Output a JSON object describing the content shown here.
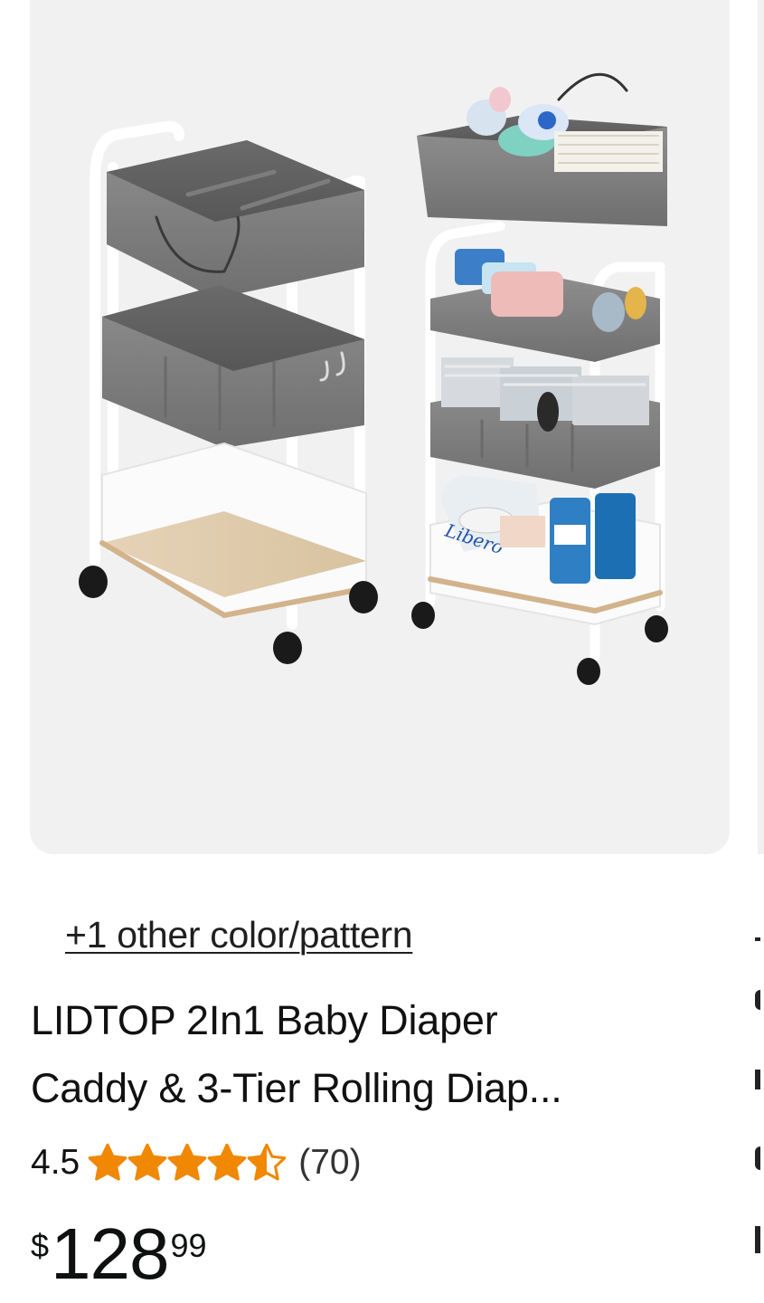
{
  "product": {
    "other_colors_label": "+1 other color/pattern",
    "title_line1": "LIDTOP 2In1 Baby Diaper",
    "title_line2": "Caddy & 3-Tier Rolling Diap...",
    "rating_value": "4.5",
    "rating_stars": 4.5,
    "review_count": "(70)",
    "price_symbol": "$",
    "price_whole": "128",
    "price_fraction": "99",
    "image_label": "Libero"
  },
  "colors": {
    "star": "#f08804",
    "card_background": "#f1f1f2",
    "text": "#111111"
  }
}
